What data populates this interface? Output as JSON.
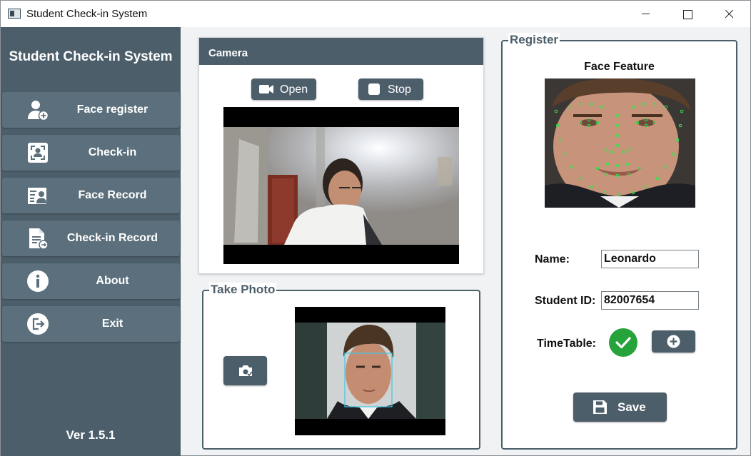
{
  "window": {
    "title": "Student Check-in System"
  },
  "sidebar": {
    "title": "Student Check-in System",
    "items": [
      {
        "label": "Face register",
        "icon": "user-add-icon"
      },
      {
        "label": "Check-in",
        "icon": "face-scan-icon"
      },
      {
        "label": "Face Record",
        "icon": "id-card-icon"
      },
      {
        "label": "Check-in Record",
        "icon": "document-icon"
      },
      {
        "label": "About",
        "icon": "info-icon"
      },
      {
        "label": "Exit",
        "icon": "exit-icon"
      }
    ],
    "version": "Ver 1.5.1"
  },
  "camera": {
    "title": "Camera",
    "open_label": "Open",
    "stop_label": "Stop"
  },
  "take_photo": {
    "title": "Take Photo"
  },
  "register": {
    "title": "Register",
    "feature_title": "Face Feature",
    "name_label": "Name:",
    "name_value": "Leonardo",
    "student_id_label": "Student ID:",
    "student_id_value": "82007654",
    "timetable_label": "TimeTable:",
    "timetable_status": "check-icon",
    "save_label": "Save"
  },
  "colors": {
    "primary": "#4c5e6a",
    "nav_item": "#5b707c",
    "success": "#27a33b",
    "landmark": "#2ee64a",
    "face_box": "#3ec9e6"
  }
}
